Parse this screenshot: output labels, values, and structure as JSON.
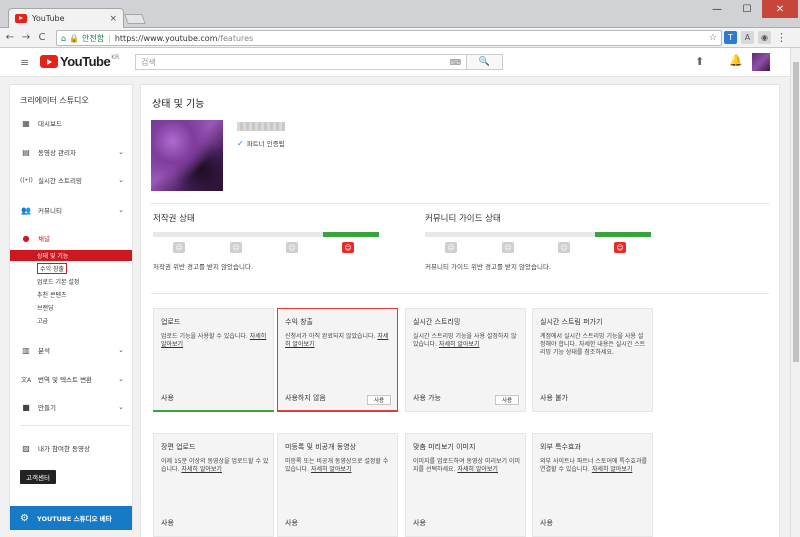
{
  "browser": {
    "tab_title": "YouTube",
    "tab_close": "×",
    "win_min": "—",
    "win_max": "☐",
    "win_close": "✕",
    "back": "←",
    "forward": "→",
    "reload": "C",
    "home": "⌂",
    "secure_label": "안전함",
    "url_host": "https://www.youtube.com",
    "url_path": "/features",
    "star": "☆",
    "ext_menu": "⋮"
  },
  "masthead": {
    "logo_text": "YouTube",
    "region": "KR",
    "search_placeholder": "검색",
    "keyboard_icon": "⌨",
    "search_icon": "🔍",
    "upload_icon": "⬆",
    "bell_icon": "🔔",
    "menu_icon": "≡"
  },
  "sidebar": {
    "header": "크리에이터 스튜디오",
    "items": [
      {
        "label": "대시보드",
        "icon": "▦"
      },
      {
        "label": "동영상 관리자",
        "icon": "▤",
        "chevron": "⌄"
      },
      {
        "label": "실시간 스트리밍",
        "icon": "((•))",
        "chevron": "⌄"
      },
      {
        "label": "커뮤니티",
        "icon": "👥",
        "chevron": "⌄"
      },
      {
        "label": "채널",
        "icon": "●"
      },
      {
        "label": "분석",
        "icon": "▥",
        "chevron": "⌄"
      },
      {
        "label": "번역 및 텍스트 변환",
        "icon": "文A",
        "chevron": "⌄"
      },
      {
        "label": "만들기",
        "icon": "■",
        "chevron": "⌄"
      },
      {
        "label": "내가 참여한 동영상",
        "icon": "▨"
      }
    ],
    "channel_sub": [
      "상태 및 기능",
      "수익 창출",
      "업로드 기본 설정",
      "추천 콘텐츠",
      "브랜딩",
      "고급"
    ],
    "help_button": "고객센터",
    "beta_label": "YOUTUBE 스튜디오 베타",
    "beta_icon": "⚙"
  },
  "main": {
    "title": "상태 및 기능",
    "partner_check": "✓",
    "partner_label": "파트너 인증됨",
    "copyright": {
      "title": "저작권 상태",
      "desc": "저작권 위반 경고를 받지 않았습니다."
    },
    "community": {
      "title": "커뮤니티 가이드 상태",
      "desc": "커뮤니티 가이드 위반 경고를 받지 않았습니다."
    },
    "cards": [
      {
        "title": "업로드",
        "desc": "업로드 기능을 사용할 수 있습니다.",
        "link": "자세히 알아보기",
        "status": "사용",
        "button": ""
      },
      {
        "title": "수익 창출",
        "desc": "신청서가 아직 완료되지 않았습니다.",
        "link": "자세히 알아보기",
        "status": "사용하지 않음",
        "button": "사용"
      },
      {
        "title": "실시간 스트리밍",
        "desc": "실시간 스트리밍 기능을 사용 설정하지 않았습니다.",
        "link": "자세히 알아보기",
        "status": "사용 가능",
        "button": "사용"
      },
      {
        "title": "실시간 스트림 퍼가기",
        "desc": "계정에서 실시간 스트리밍 기능을 사용 설정해야 합니다. 자세한 내용은 실시간 스트리밍 기능 상태를 참조하세요.",
        "link": "",
        "status": "사용 불가",
        "button": ""
      },
      {
        "title": "장편 업로드",
        "desc": "이제 15분 이상의 동영상을 업로드할 수 있습니다.",
        "link": "자세히 알아보기",
        "status": "사용",
        "button": ""
      },
      {
        "title": "미등록 및 비공개 동영상",
        "desc": "미등록 또는 비공개 동영상으로 설정할 수 있습니다.",
        "link": "자세히 알아보기",
        "status": "사용",
        "button": ""
      },
      {
        "title": "맞춤 미리보기 이미지",
        "desc": "이미지를 업로드하여 동영상 미리보기 이미지를 선택하세요.",
        "link": "자세히 알아보기",
        "status": "사용",
        "button": ""
      },
      {
        "title": "외부 특수효과",
        "desc": "외부 사이트나 파트너 스토어에 특수효과를 연결할 수 있습니다.",
        "link": "자세히 알아보기",
        "status": "사용",
        "button": ""
      }
    ]
  }
}
